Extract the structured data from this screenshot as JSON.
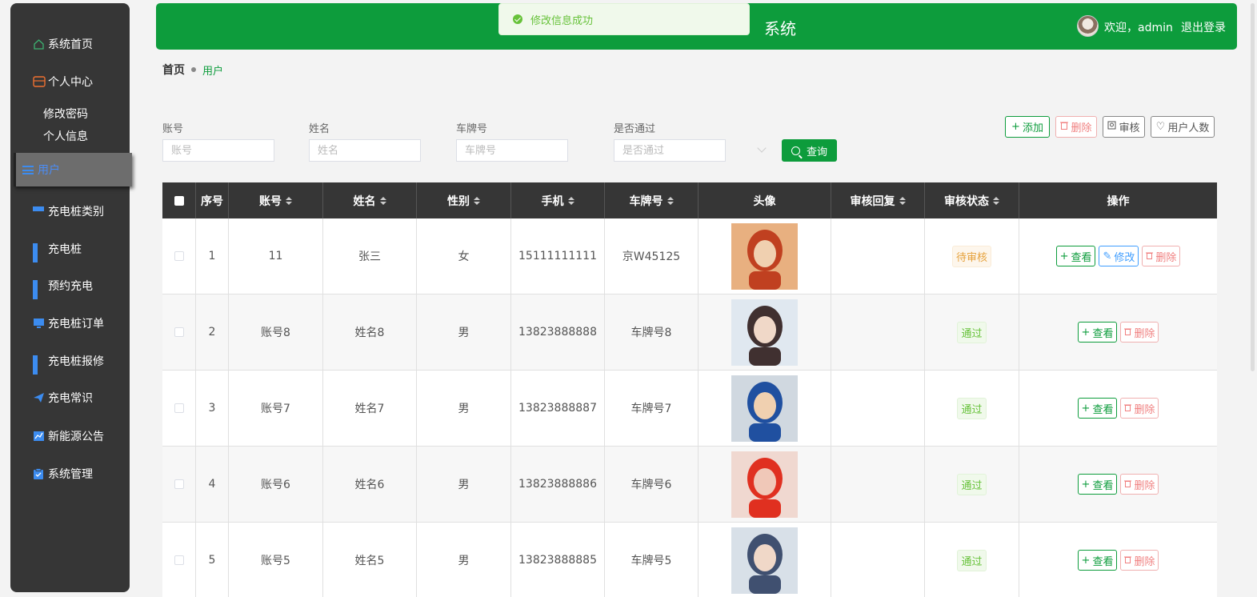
{
  "sidebar": {
    "home": "系统首页",
    "personal": "个人中心",
    "sub": [
      "修改密码",
      "个人信息"
    ],
    "active": "用户",
    "items": [
      "充电桩类别",
      "充电桩",
      "预约充电",
      "充电桩订单",
      "充电桩报修",
      "充电常识",
      "新能源公告",
      "系统管理"
    ]
  },
  "header": {
    "title": "系统",
    "welcome": "欢迎，admin",
    "logout": "退出登录"
  },
  "toast": "修改信息成功",
  "breadcrumb": {
    "home": "首页",
    "current": "用户"
  },
  "search": {
    "fields": [
      {
        "label": "账号",
        "placeholder": "账号"
      },
      {
        "label": "姓名",
        "placeholder": "姓名"
      },
      {
        "label": "车牌号",
        "placeholder": "车牌号"
      },
      {
        "label": "是否通过",
        "placeholder": "是否通过"
      }
    ],
    "query": "查询"
  },
  "actions": {
    "add": "添加",
    "delete": "删除",
    "audit": "审核",
    "count": "用户人数"
  },
  "table": {
    "headers": [
      "序号",
      "账号",
      "姓名",
      "性别",
      "手机",
      "车牌号",
      "头像",
      "审核回复",
      "审核状态",
      "操作"
    ],
    "rows": [
      {
        "idx": "1",
        "account": "11",
        "name": "张三",
        "gender": "女",
        "phone": "15111111111",
        "plate": "京W45125",
        "reply": "",
        "status": "待审核",
        "status_type": "warn",
        "ops": [
          "查看",
          "修改",
          "删除"
        ]
      },
      {
        "idx": "2",
        "account": "账号8",
        "name": "姓名8",
        "gender": "男",
        "phone": "13823888888",
        "plate": "车牌号8",
        "reply": "",
        "status": "通过",
        "status_type": "ok",
        "ops": [
          "查看",
          "删除"
        ]
      },
      {
        "idx": "3",
        "account": "账号7",
        "name": "姓名7",
        "gender": "男",
        "phone": "13823888887",
        "plate": "车牌号7",
        "reply": "",
        "status": "通过",
        "status_type": "ok",
        "ops": [
          "查看",
          "删除"
        ]
      },
      {
        "idx": "4",
        "account": "账号6",
        "name": "姓名6",
        "gender": "男",
        "phone": "13823888886",
        "plate": "车牌号6",
        "reply": "",
        "status": "通过",
        "status_type": "ok",
        "ops": [
          "查看",
          "删除"
        ]
      },
      {
        "idx": "5",
        "account": "账号5",
        "name": "姓名5",
        "gender": "男",
        "phone": "13823888885",
        "plate": "车牌号5",
        "reply": "",
        "status": "通过",
        "status_type": "ok",
        "ops": [
          "查看",
          "删除"
        ]
      }
    ]
  },
  "colors": {
    "primary": "#0d9c3c",
    "sidebar": "#363636",
    "accent_blue": "#409eff"
  }
}
